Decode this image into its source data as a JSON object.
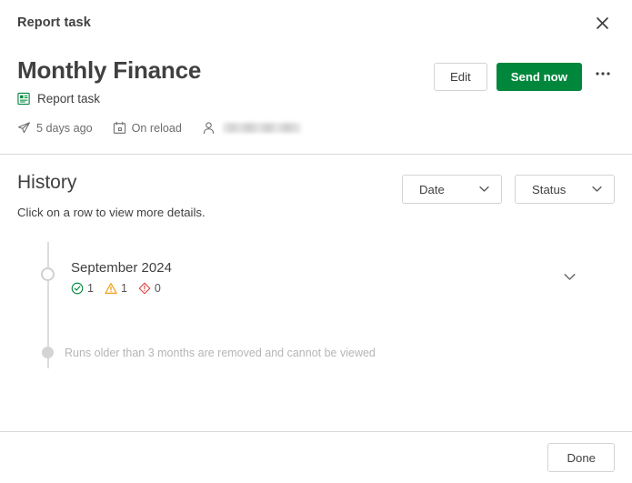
{
  "topbar": {
    "title": "Report task",
    "close_icon": "close-icon"
  },
  "header": {
    "title": "Monthly Finance",
    "type_icon": "report-task-icon",
    "type_label": "Report task",
    "meta": {
      "last_run_icon": "send-icon",
      "last_run": "5 days ago",
      "schedule_icon": "calendar-icon",
      "schedule": "On reload",
      "owner_icon": "person-icon",
      "owner": ""
    },
    "actions": {
      "edit_label": "Edit",
      "send_label": "Send now",
      "more_label": "•••",
      "more_icon": "ellipsis-icon"
    }
  },
  "history": {
    "title": "History",
    "subtitle": "Click on a row to view more details.",
    "filters": [
      {
        "label": "Date",
        "icon": "chevron-down-icon"
      },
      {
        "label": "Status",
        "icon": "chevron-down-icon"
      }
    ],
    "rows": [
      {
        "date": "September 2024",
        "expand_icon": "chevron-down-icon",
        "stats": [
          {
            "icon": "check-circle-icon",
            "value": "1",
            "color": "#00873c"
          },
          {
            "icon": "warning-triangle-icon",
            "value": "1",
            "color": "#ef9600"
          },
          {
            "icon": "error-diamond-icon",
            "value": "0",
            "color": "#dc423f"
          }
        ]
      }
    ],
    "note": "Runs older than 3 months are removed and cannot be viewed"
  },
  "footer": {
    "done_label": "Done"
  },
  "colors": {
    "accent_green": "#00873c",
    "text": "#404040",
    "muted": "#6c6c6c",
    "border": "#d3d3d3",
    "divider": "#d9d9d9",
    "note": "#b5b5b5"
  }
}
